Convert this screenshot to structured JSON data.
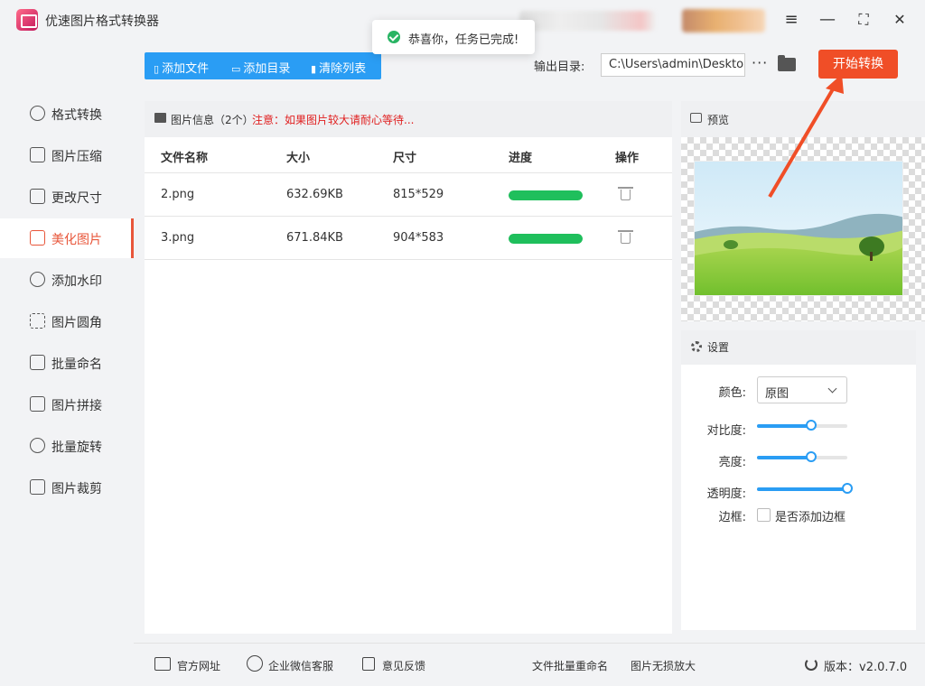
{
  "app": {
    "title": "优速图片格式转换器"
  },
  "toast": {
    "message": "恭喜你，任务已完成!"
  },
  "window_controls": {
    "menu": "≡",
    "minimize": "—",
    "maximize": "⛶",
    "close": "✕"
  },
  "toolbar": {
    "add_file": "添加文件",
    "add_dir": "添加目录",
    "clear_list": "清除列表",
    "output_label": "输出目录:",
    "output_path": "C:\\Users\\admin\\Deskto",
    "more": "···",
    "start": "开始转换"
  },
  "sidebar": {
    "items": [
      {
        "label": "格式转换",
        "icon": "swap-icon"
      },
      {
        "label": "图片压缩",
        "icon": "compress-icon"
      },
      {
        "label": "更改尺寸",
        "icon": "resize-icon"
      },
      {
        "label": "美化图片",
        "icon": "beautify-icon",
        "active": true
      },
      {
        "label": "添加水印",
        "icon": "watermark-icon"
      },
      {
        "label": "图片圆角",
        "icon": "round-corner-icon"
      },
      {
        "label": "批量命名",
        "icon": "rename-icon"
      },
      {
        "label": "图片拼接",
        "icon": "stitch-icon"
      },
      {
        "label": "批量旋转",
        "icon": "rotate-icon"
      },
      {
        "label": "图片裁剪",
        "icon": "crop-icon"
      }
    ]
  },
  "file_panel": {
    "title": "图片信息（2个）",
    "warning": "注意：如果图片较大请耐心等待...",
    "columns": [
      "文件名称",
      "大小",
      "尺寸",
      "进度",
      "操作"
    ],
    "rows": [
      {
        "name": "2.png",
        "size": "632.69KB",
        "dims": "815*529",
        "progress": 1.0
      },
      {
        "name": "3.png",
        "size": "671.84KB",
        "dims": "904*583",
        "progress": 1.0
      }
    ]
  },
  "preview": {
    "title": "预览"
  },
  "settings": {
    "title": "设置",
    "color_label": "颜色:",
    "color_value": "原图",
    "contrast_label": "对比度:",
    "contrast_value": 0.6,
    "brightness_label": "亮度:",
    "brightness_value": 0.6,
    "opacity_label": "透明度:",
    "opacity_value": 1.0,
    "border_label": "边框:",
    "border_option": "是否添加边框",
    "border_checked": false
  },
  "footer": {
    "website": "官方网址",
    "wechat": "企业微信客服",
    "feedback": "意见反馈",
    "batch_rename": "文件批量重命名",
    "lossless": "图片无损放大",
    "version": "版本：v2.0.7.0"
  },
  "colors": {
    "accent": "#2a9df4",
    "start_button": "#f04e27",
    "active": "#e8563a",
    "progress": "#1fbf5c",
    "warning": "#e02020"
  }
}
